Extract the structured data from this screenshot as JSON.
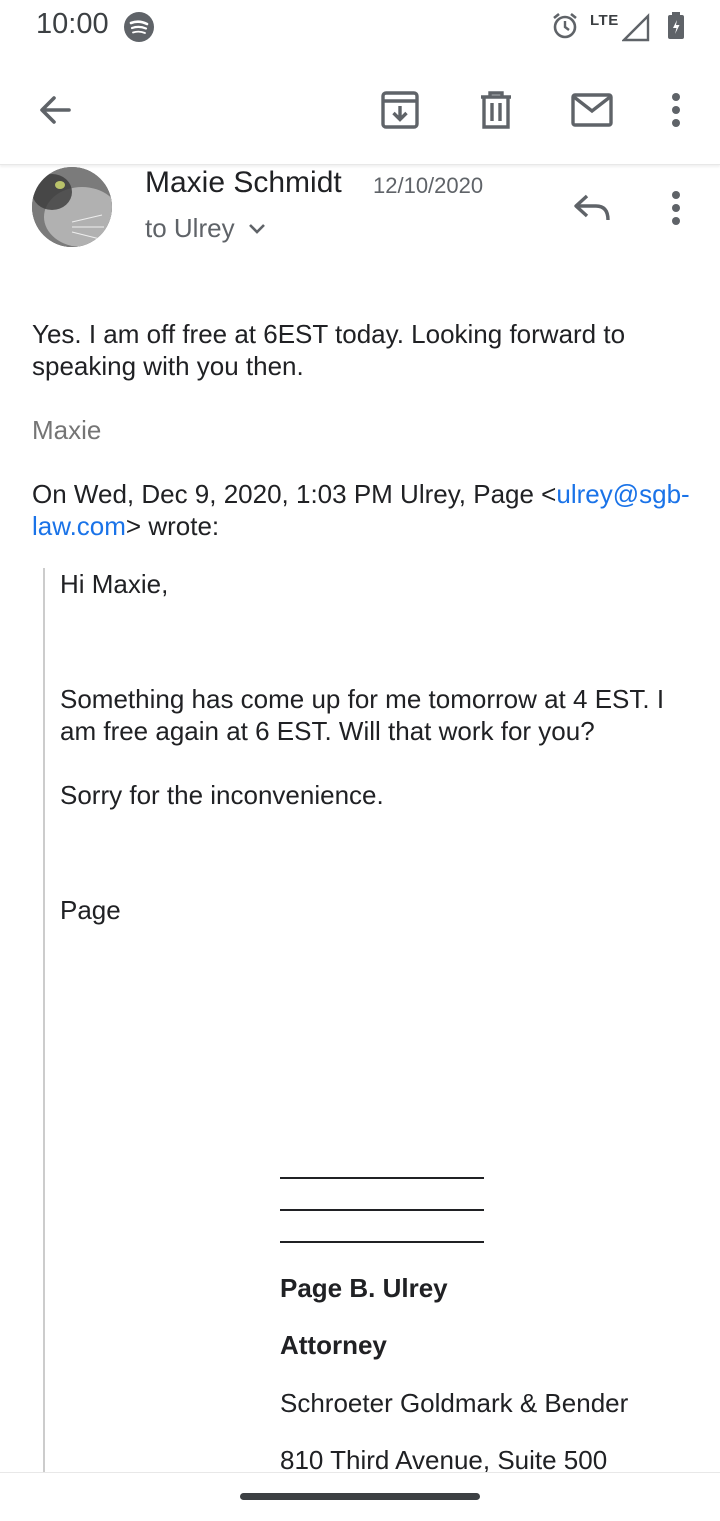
{
  "status_bar": {
    "time": "10:00",
    "network": "LTE"
  },
  "toolbar": {
    "icons": [
      "back-arrow-icon",
      "archive-icon",
      "trash-icon",
      "mail-icon",
      "more-vert-icon"
    ]
  },
  "message": {
    "sender": "Maxie Schmidt",
    "date": "12/10/2020",
    "recipients": "to Ulrey",
    "body": "Yes. I am off free at 6EST today. Looking forward to speaking with you then.",
    "sign_off": "Maxie",
    "quote_header_prefix": "On Wed, Dec 9, 2020, 1:03 PM Ulrey, Page <",
    "quote_email": "ulrey@sgb-law.com",
    "quote_header_suffix": "> wrote:"
  },
  "quoted": {
    "greeting": "Hi Maxie,",
    "para1": "Something has come up for me tomorrow at 4 EST. I am free again at 6 EST. Will that work for you?",
    "para2": "Sorry for the inconvenience.",
    "name": "Page",
    "signature": {
      "name": "Page B. Ulrey",
      "title": "Attorney",
      "firm": "Schroeter Goldmark & Bender",
      "address": "810 Third Avenue, Suite 500"
    }
  },
  "colors": {
    "link": "#1a73e8",
    "text": "#202124",
    "secondary": "#5f6368"
  }
}
